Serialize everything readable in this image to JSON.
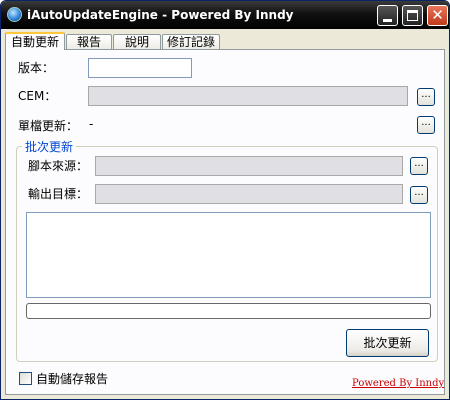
{
  "window": {
    "title": "iAutoUpdateEngine - Powered By Inndy",
    "min_icon": "minimize-icon",
    "max_icon": "maximize-icon",
    "close_icon": "close-icon",
    "close_glyph": "✕"
  },
  "tabs": [
    {
      "label": "自動更新",
      "active": true
    },
    {
      "label": "報告",
      "active": false
    },
    {
      "label": "說明",
      "active": false
    },
    {
      "label": "修訂記錄",
      "active": false
    }
  ],
  "form": {
    "version_label": "版本：",
    "version_value": "",
    "cem_label": "CEM：",
    "cem_value": "",
    "single_update_label": "單檔更新：",
    "single_update_value": "-",
    "browse_label": "..."
  },
  "batch": {
    "group_title": "批次更新",
    "script_source_label": "腳本來源：",
    "script_source_value": "",
    "output_dir_label": "輸出目標：",
    "output_dir_value": "",
    "log_text": "",
    "progress": 0,
    "button_label": "批次更新"
  },
  "footer": {
    "autosave_label": "自動儲存報告",
    "autosave_checked": false,
    "powered_by": "Powered By Inndy"
  },
  "colors": {
    "title_bar": "#000000",
    "group_title": "#0046d5",
    "link": "#cc0000",
    "tab_highlight": "#ffc83c"
  }
}
